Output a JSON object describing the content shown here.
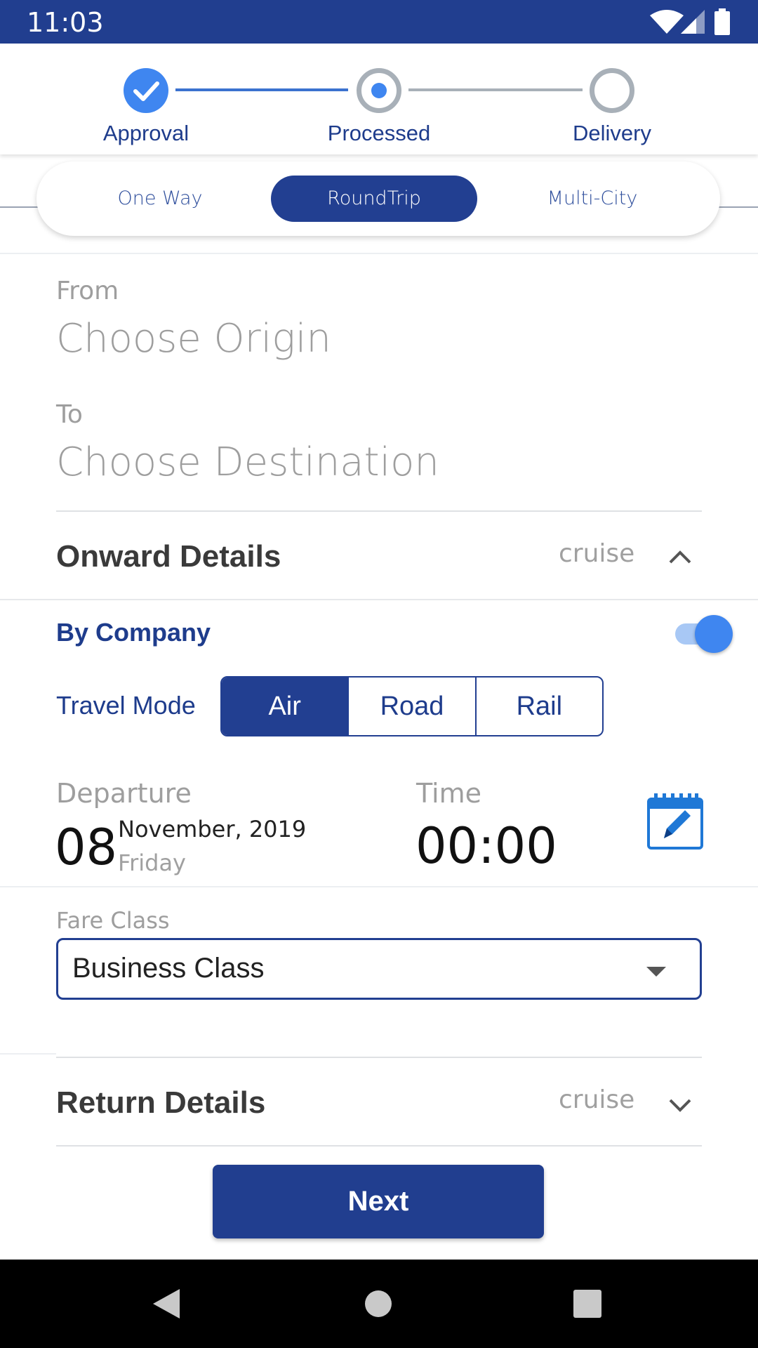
{
  "status_bar": {
    "time": "11:03"
  },
  "stepper": {
    "steps": [
      {
        "label": "Approval",
        "state": "done"
      },
      {
        "label": "Processed",
        "state": "current"
      },
      {
        "label": "Delivery",
        "state": "pending"
      }
    ]
  },
  "trip_type": {
    "options": [
      "One Way",
      "RoundTrip",
      "Multi-City"
    ],
    "selected": "RoundTrip"
  },
  "route": {
    "from_label": "From",
    "from_placeholder": "Choose Origin",
    "to_label": "To",
    "to_placeholder": "Choose Destination"
  },
  "onward": {
    "title": "Onward Details",
    "subtitle": "cruise",
    "by_company_label": "By Company",
    "by_company_enabled": true,
    "travel_mode_label": "Travel Mode",
    "modes": [
      "Air",
      "Road",
      "Rail"
    ],
    "selected_mode": "Air",
    "departure_label": "Departure",
    "departure_day": "08",
    "departure_month_year": "November, 2019",
    "departure_weekday": "Friday",
    "time_label": "Time",
    "time_value": "00:00",
    "fare_label": "Fare Class",
    "fare_value": "Business Class"
  },
  "return": {
    "title": "Return Details",
    "subtitle": "cruise"
  },
  "next_label": "Next",
  "colors": {
    "primary": "#213e8f",
    "accent": "#3f86f0",
    "muted": "#9e9e9e"
  },
  "icons": {
    "calendar_edit": "calendar-edit-icon",
    "chevron_up": "chevron-up-icon",
    "chevron_down": "chevron-down-icon"
  }
}
